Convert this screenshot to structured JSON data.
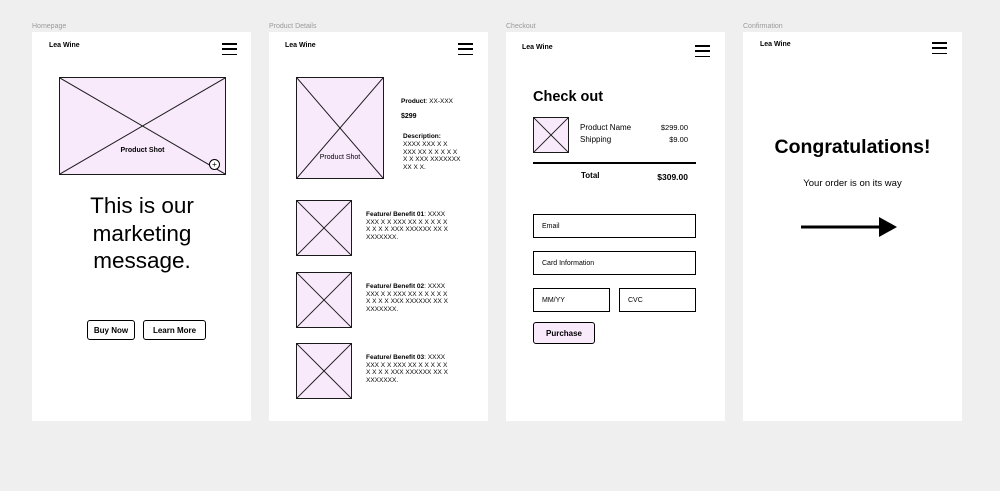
{
  "frames": {
    "homepage": {
      "label": "Homepage",
      "brand": "Lea Wine",
      "product_shot": "Product Shot",
      "message": "This is our marketing message.",
      "buy_now": "Buy Now",
      "learn_more": "Learn More"
    },
    "product_details": {
      "label": "Product Details",
      "brand": "Lea Wine",
      "product_shot": "Product Shot",
      "product_label": "Product",
      "product_value": ": XX-XXX",
      "price": "$299",
      "description_label": "Description:",
      "description_text": "XXXX XXX X X XXX XX X X X X X X X XXX XXXXXXX XX X X.",
      "features": [
        {
          "label": "Feature/ Benefit 01",
          "text": ": XXXX XXX X X XXX XX X X X X X X X X X XXX XXXXXX XX X XXXXXXX."
        },
        {
          "label": "Feature/ Benefit 02",
          "text": ": XXXX XXX X X XXX XX X X X X X X X X X XXX XXXXXX XX X XXXXXXX."
        },
        {
          "label": "Feature/ Benefit 03",
          "text": ": XXXX XXX X X XXX XX X X X X X X X X X XXX XXXXXX XX X XXXXXXX."
        }
      ]
    },
    "checkout": {
      "label": "Checkout",
      "brand": "Lea Wine",
      "title": "Check out",
      "product_name": "Product Name",
      "product_price": "$299.00",
      "shipping_label": "Shipping",
      "shipping_price": "$9.00",
      "total_label": "Total",
      "total_value": "$309.00",
      "email_placeholder": "Email",
      "card_placeholder": "Card Information",
      "mmyy_placeholder": "MM/YY",
      "cvc_placeholder": "CVC",
      "purchase": "Purchase"
    },
    "confirmation": {
      "label": "Confirmation",
      "brand": "Lea Wine",
      "title": "Congratulations!",
      "subtitle": "Your order is on its way"
    }
  },
  "colors": {
    "placeholder_fill": "#f8e9fb",
    "canvas_bg": "#efefef",
    "frame_bg": "#ffffff"
  }
}
